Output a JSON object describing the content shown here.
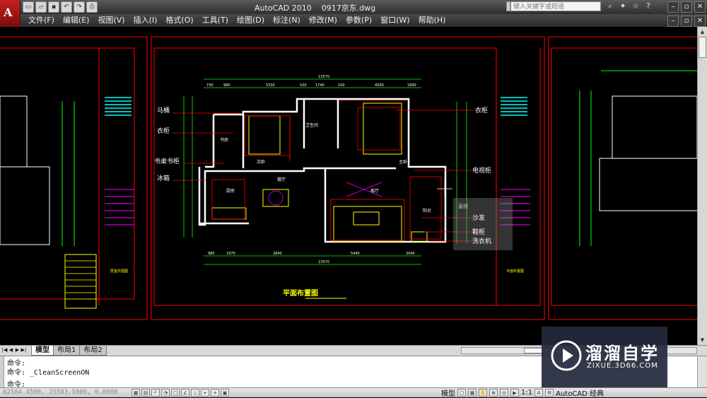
{
  "titlebar": {
    "app_logo_letter": "A",
    "title": "AutoCAD 2010    0917京东.dwg",
    "search_placeholder": "键入关键字或短语",
    "quick_access": [
      "new-icon",
      "open-icon",
      "save-icon",
      "undo-icon",
      "redo-icon",
      "plot-icon"
    ]
  },
  "menu": {
    "items": [
      "文件(F)",
      "编辑(E)",
      "视图(V)",
      "插入(I)",
      "格式(O)",
      "工具(T)",
      "绘图(D)",
      "标注(N)",
      "修改(M)",
      "参数(P)",
      "窗口(W)",
      "帮助(H)"
    ]
  },
  "drawing": {
    "main_title": "平面布置图",
    "room_labels": {
      "bathroom": "卫生间",
      "study": "书房",
      "bedroom2": "次卧",
      "master": "主卧",
      "dining": "餐厅",
      "kitchen": "厨房",
      "living": "客厅",
      "balcony": "阳台"
    },
    "left_callouts": [
      "马桶",
      "衣柜",
      "书桌书柜",
      "冰箱"
    ],
    "right_callouts": [
      "衣柜",
      "电视柜"
    ],
    "popup_labels": [
      "沙发",
      "鞋柜",
      "洗衣机"
    ],
    "popup_hint": "直线",
    "dim_top": [
      "13570",
      "730",
      "980",
      "5330",
      "100",
      "1740",
      "100",
      "4500",
      "1890"
    ],
    "dim_bottom": [
      "980",
      "1970",
      "2840",
      "5440",
      "2040",
      "13570"
    ],
    "left_panel_text": "层室外围图",
    "right_panel_text": "平面布置图"
  },
  "tabs": {
    "items": [
      "模型",
      "布局1",
      "布局2"
    ],
    "active_index": 0
  },
  "command": {
    "lines": [
      "命令:",
      "命令: _CleanScreenON",
      "命令:"
    ]
  },
  "status": {
    "coords": "62584.4500, 25583.5000, 0.0000",
    "model_label": "模型",
    "scale": "1:1",
    "workspace": "AutoCAD 经典"
  },
  "watermark": {
    "title": "溜溜自学",
    "url": "ZIXUE.3D66.COM"
  },
  "colors": {
    "cad_red": "#ff0000",
    "cad_yellow": "#ffff00",
    "cad_cyan": "#00ffff",
    "cad_green": "#00ff00",
    "cad_magenta": "#ff00ff",
    "cad_white": "#ffffff"
  }
}
